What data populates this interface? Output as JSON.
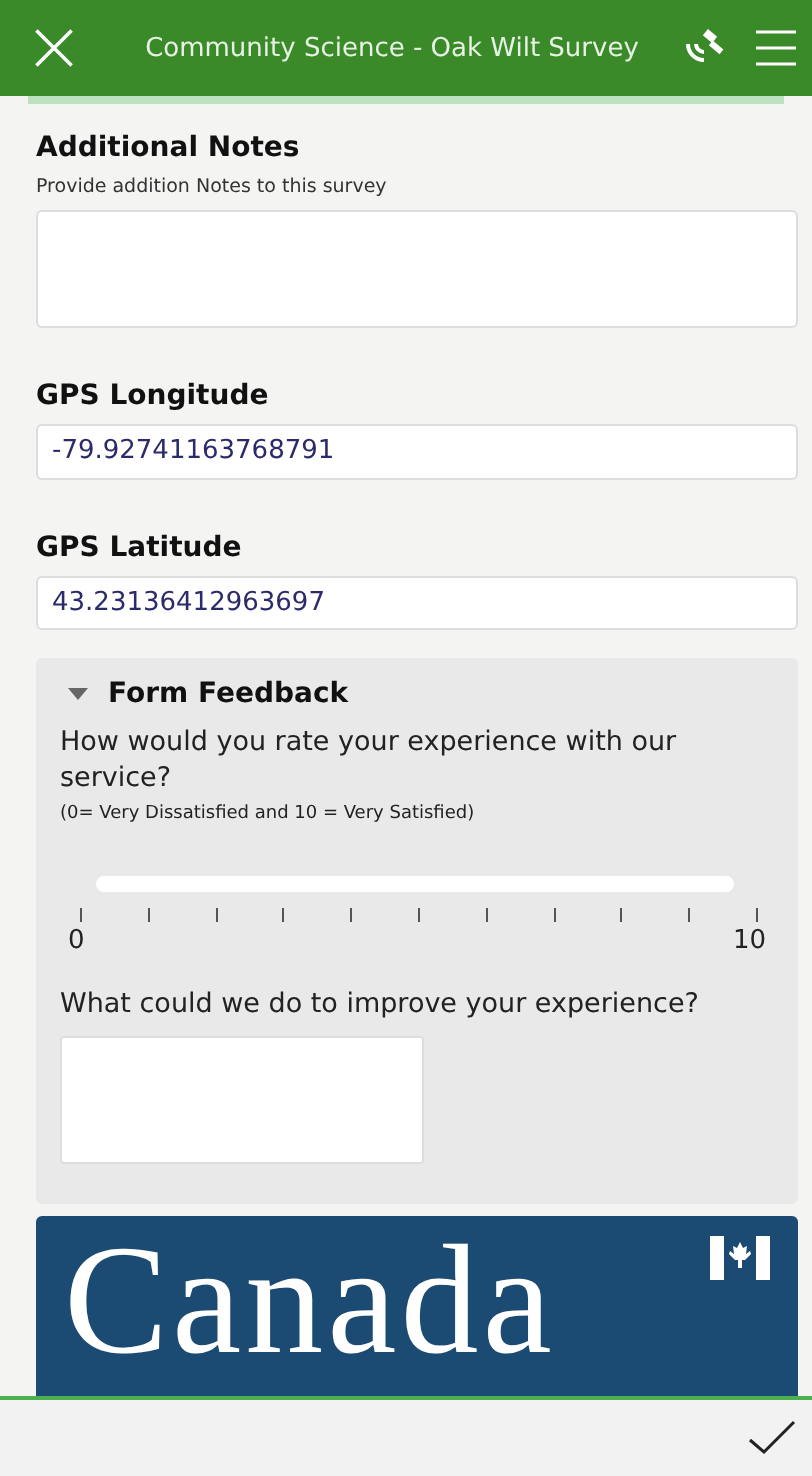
{
  "header": {
    "title": "Community Science - Oak Wilt Survey"
  },
  "notes": {
    "label": "Additional Notes",
    "hint": "Provide addition Notes to this survey"
  },
  "fields": [
    {
      "label": "GPS Longitude",
      "value": "-79.92741163768791"
    },
    {
      "label": "GPS Latitude",
      "value": "43.23136412963697"
    }
  ],
  "feedback": {
    "title": "Form Feedback",
    "expanded": true,
    "question": "How would you rate your experience with our service?",
    "scale_hint": "(0= Very Dissatisfied and 10 = Very Satisfied)",
    "min_label": "0",
    "max_label": "10",
    "improve_question": "What could we do to improve your experience?"
  },
  "banner": {
    "text": "Canada"
  }
}
